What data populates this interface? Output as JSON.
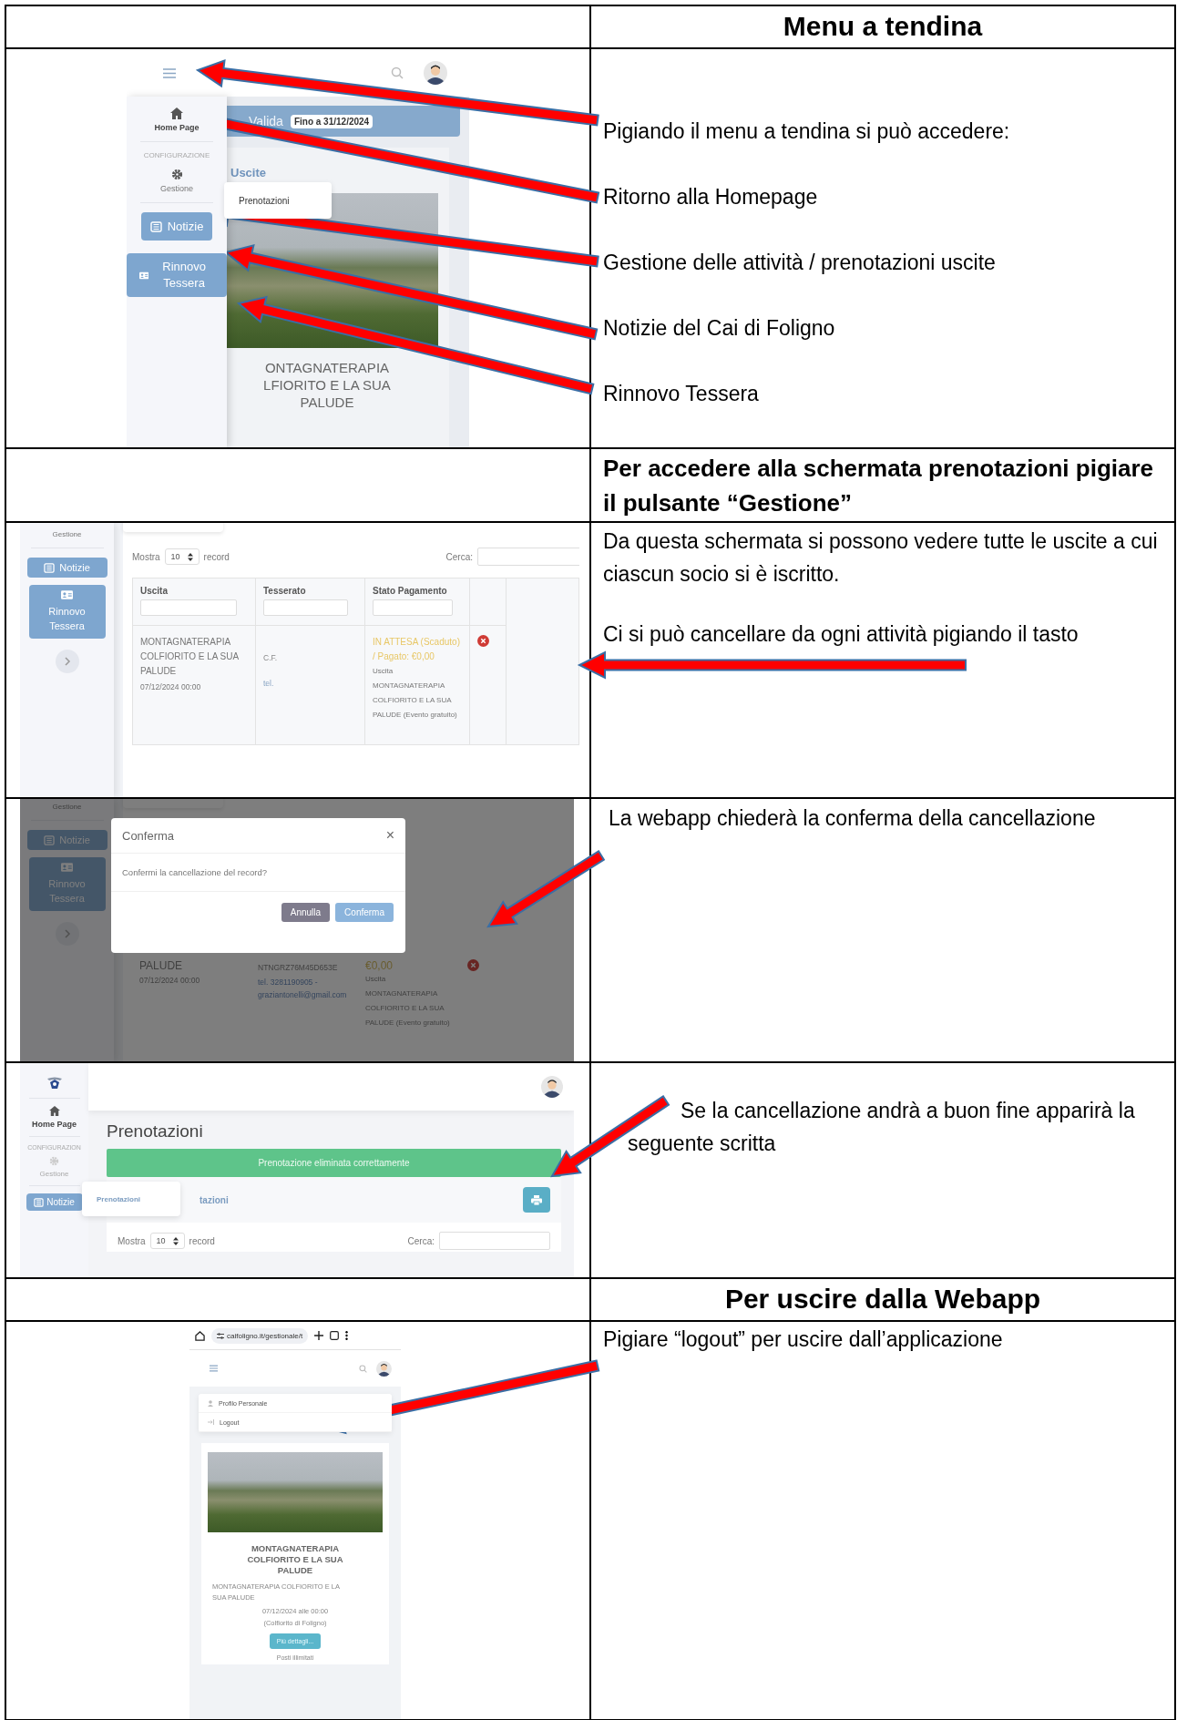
{
  "rows": [
    {
      "kind": "title",
      "note": "Menu a tendina"
    },
    {
      "kind": "menu",
      "screen": {
        "sidebar": {
          "home": "Home Page",
          "section": "CONFIGURAZIONE",
          "manage": "Gestione",
          "buttons": [
            "Notizie",
            "Rinnovo Tessera"
          ]
        },
        "banner": {
          "text": "Valida",
          "badge": "Fino a 31/12/2024"
        },
        "card_title": "Uscite",
        "popup": "Prenotazioni",
        "event_title": "ONTAGNATERAPIA LFIORITO E LA SUA PALUDE"
      },
      "notes": [
        "Pigiando il menu a tendina si può accedere:",
        "Ritorno alla Homepage",
        "Gestione delle attività / prenotazioni uscite",
        "Notizie del Cai di Foligno",
        "Rinnovo Tessera"
      ]
    },
    {
      "kind": "instruction",
      "note": "Per accedere alla schermata prenotazioni pigiare il pulsante “Gestione”"
    },
    {
      "kind": "bookings",
      "screen": {
        "sidebar": {
          "manage": "Gestione",
          "buttons": [
            "Notizie",
            "Rinnovo Tessera"
          ]
        },
        "length": {
          "label": "Mostra",
          "value": "10",
          "suffix": "record"
        },
        "search_label": "Cerca:",
        "columns": [
          "Uscita",
          "Tesserato",
          "Stato Pagamento"
        ],
        "row": {
          "event": "MONTAGNATERAPIA COLFIORITO E LA SUA PALUDE",
          "date": "07/12/2024 00:00",
          "member": [
            "C.F.",
            "tel."
          ],
          "status": "IN ATTESA (Scaduto) / Pagato: €0,00",
          "detail": "Uscita MONTAGNATERAPIA COLFIORITO E LA SUA PALUDE (Evento gratuito)"
        }
      },
      "notes": [
        "Da questa schermata si possono vedere tutte le uscite a cui ciascun socio si è iscritto.",
        "Ci si può cancellare da ogni attività pigiando il tasto"
      ]
    },
    {
      "kind": "confirm",
      "screen": {
        "sidebar": {
          "manage": "Gestione",
          "buttons": [
            "Notizie",
            "Rinnovo Tessera"
          ]
        },
        "row": {
          "event": "PALUDE",
          "date": "07/12/2024 00:00",
          "tax_code": "NTNGRZ76M45D653E",
          "contact": "tel. 3281190905 - graziantonelli@gmail.com",
          "status": "€0,00",
          "detail": "Uscita MONTAGNATERAPIA COLFIORITO E LA SUA PALUDE (Evento gratuito)"
        },
        "dialog": {
          "title": "Conferma",
          "close": "×",
          "message": "Confermi la cancellazione del record?",
          "buttons": [
            {
              "label": "Annulla",
              "kind": "secondary"
            },
            {
              "label": "Conferma",
              "kind": "primary"
            }
          ]
        }
      },
      "notes": [
        "La webapp chiederà la conferma della cancellazione"
      ]
    },
    {
      "kind": "success",
      "screen": {
        "sidebar": {
          "home": "Home Page",
          "section": "CONFIGURAZION",
          "manage": "Gestione",
          "buttons": [
            "Notizie"
          ]
        },
        "page_title": "Prenotazioni",
        "alert": "Prenotazione eliminata correttamente",
        "card_title": "tazioni",
        "popup": "Prenotazioni",
        "length": {
          "label": "Mostra",
          "value": "10",
          "suffix": "record"
        },
        "search_label": "Cerca:"
      },
      "notes": [
        "Se la cancellazione andrà a buon fine apparirà la seguente scritta"
      ]
    },
    {
      "kind": "title",
      "note": "Per uscire dalla Webapp"
    },
    {
      "kind": "logout",
      "screen": {
        "url": "caifoligno.it/gestionale/t",
        "menu": [
          {
            "label": "Profilo Personale",
            "kind": "profile"
          },
          {
            "label": "Logout",
            "kind": "logout"
          }
        ],
        "card": {
          "title": "MONTAGNATERAPIA COLFIORITO E LA SUA PALUDE",
          "description": "MONTAGNATERAPIA COLFIORITO E LA SUA PALUDE",
          "date": "07/12/2024 alle 00:00",
          "place": "(Colfiorito di Foligno)",
          "button": "Più dettagli...",
          "seats": "Posti illimitati"
        }
      },
      "notes": [
        "Pigiare “logout” per uscire dall’applicazione"
      ]
    }
  ]
}
